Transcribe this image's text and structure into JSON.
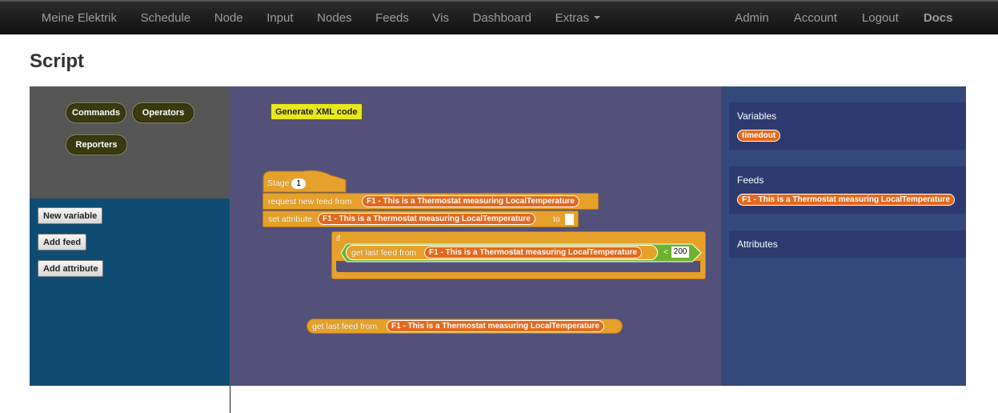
{
  "nav": {
    "left": [
      "Meine Elektrik",
      "Schedule",
      "Node",
      "Input",
      "Nodes",
      "Feeds",
      "Vis",
      "Dashboard",
      "Extras"
    ],
    "right": [
      "Admin",
      "Account",
      "Logout",
      "Docs"
    ]
  },
  "page": {
    "title": "Script"
  },
  "palette": {
    "categories": [
      "Commands",
      "Operators",
      "Reporters"
    ],
    "buttons": [
      "New variable",
      "Add feed",
      "Add attribute"
    ]
  },
  "script": {
    "generate_label": "Generate XML code",
    "stage_label": "Stage",
    "stage_value": "1",
    "request_label": "request new feed from",
    "feed_name": "F1 - This is a Thermostat measuring LocalTemperature",
    "set_label": "set attribute",
    "to_label": "to",
    "if_label": "if",
    "get_label": "get last feed from",
    "op_label": "<",
    "compare_value": "200"
  },
  "right_panel": {
    "variables_label": "Variables",
    "variable": "timedout",
    "feeds_label": "Feeds",
    "feed": "F1 - This is a Thermostat measuring LocalTemperature",
    "attributes_label": "Attributes"
  },
  "colors": {
    "navbar": "#1b1b1b",
    "script_bg": "#53507a",
    "block": "#e6a12a",
    "pill": "#e2691e",
    "condition": "#6cb42c",
    "palette_bottom": "#0f4c73"
  }
}
